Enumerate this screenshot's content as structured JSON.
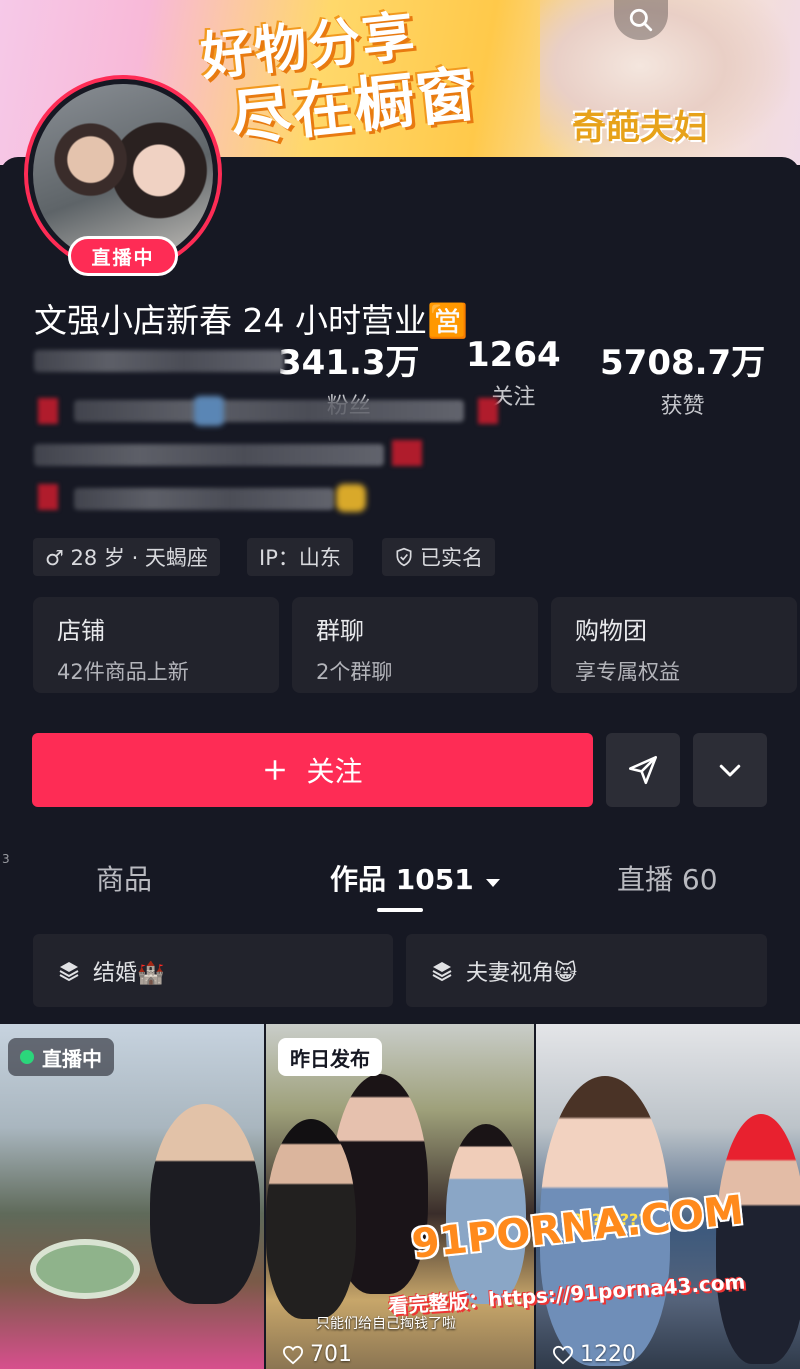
{
  "banner": {
    "line1": "好物分享",
    "line2": "尽在橱窗",
    "sticker": "奇葩夫妇",
    "search_icon": "search-icon"
  },
  "profile": {
    "live_badge": "直播中",
    "stats": [
      {
        "value": "341.3万",
        "label": "粉丝"
      },
      {
        "value": "1264",
        "label": "关注"
      },
      {
        "value": "5708.7万",
        "label": "获赞"
      }
    ],
    "nickname": "文强小店新春 24 小时营业🈺",
    "tags": [
      {
        "icon": "male-icon",
        "text": "♂ 28 岁 · 天蝎座"
      },
      {
        "icon": "",
        "text": "IP：山东"
      },
      {
        "icon": "verified-shield-icon",
        "text": "已实名"
      }
    ],
    "features": [
      {
        "title": "店铺",
        "subtitle": "42件商品上新"
      },
      {
        "title": "群聊",
        "subtitle": "2个群聊"
      },
      {
        "title": "购物团",
        "subtitle": "享专属权益"
      }
    ]
  },
  "actions": {
    "follow_label": "关注",
    "follow_icon": "plus-icon",
    "share_icon": "send-icon",
    "more_icon": "chevron-down-icon"
  },
  "tabs": {
    "edge_mark": "3",
    "items": [
      {
        "label": "商品",
        "count": ""
      },
      {
        "label": "作品",
        "count": "1051"
      },
      {
        "label": "直播",
        "count": "60"
      }
    ],
    "active_index": 1
  },
  "collections": [
    {
      "icon": "layers-icon",
      "label": "结婚🏰"
    },
    {
      "icon": "layers-icon",
      "label": "夫妻视角😸"
    }
  ],
  "videos": [
    {
      "badge": "直播中",
      "likes": ""
    },
    {
      "badge": "昨日发布",
      "likes": "701",
      "caption": "只能们给自己掏钱了啦"
    },
    {
      "badge": "",
      "likes": "1220",
      "overlay": "?????????"
    }
  ],
  "watermark": {
    "logo": "91PORNA.COM",
    "url": "看完整版：https://91porna43.com"
  },
  "colors": {
    "accent": "#fe2c55",
    "background": "#161823",
    "surface": "#22232c"
  }
}
